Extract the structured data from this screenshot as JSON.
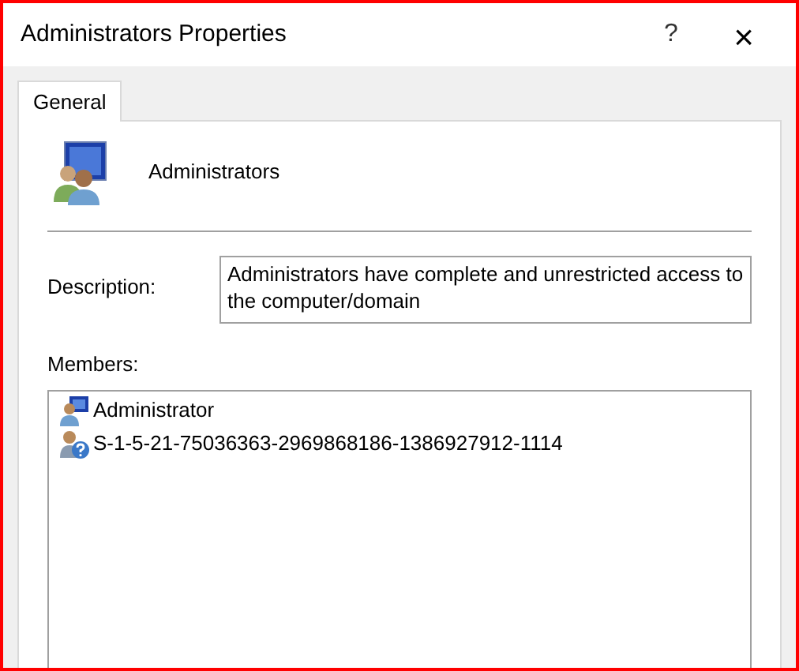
{
  "window": {
    "title": "Administrators Properties",
    "help_glyph": "?",
    "close_glyph": "×"
  },
  "tabs": [
    {
      "label": "General",
      "selected": true
    }
  ],
  "group": {
    "name": "Administrators"
  },
  "description": {
    "label": "Description:",
    "value": "Administrators have complete and unrestricted access to the computer/domain"
  },
  "members": {
    "label": "Members:",
    "items": [
      {
        "name": "Administrator",
        "kind": "user"
      },
      {
        "name": "S-1-5-21-75036363-2969868186-1386927912-1114",
        "kind": "unknown"
      }
    ]
  }
}
